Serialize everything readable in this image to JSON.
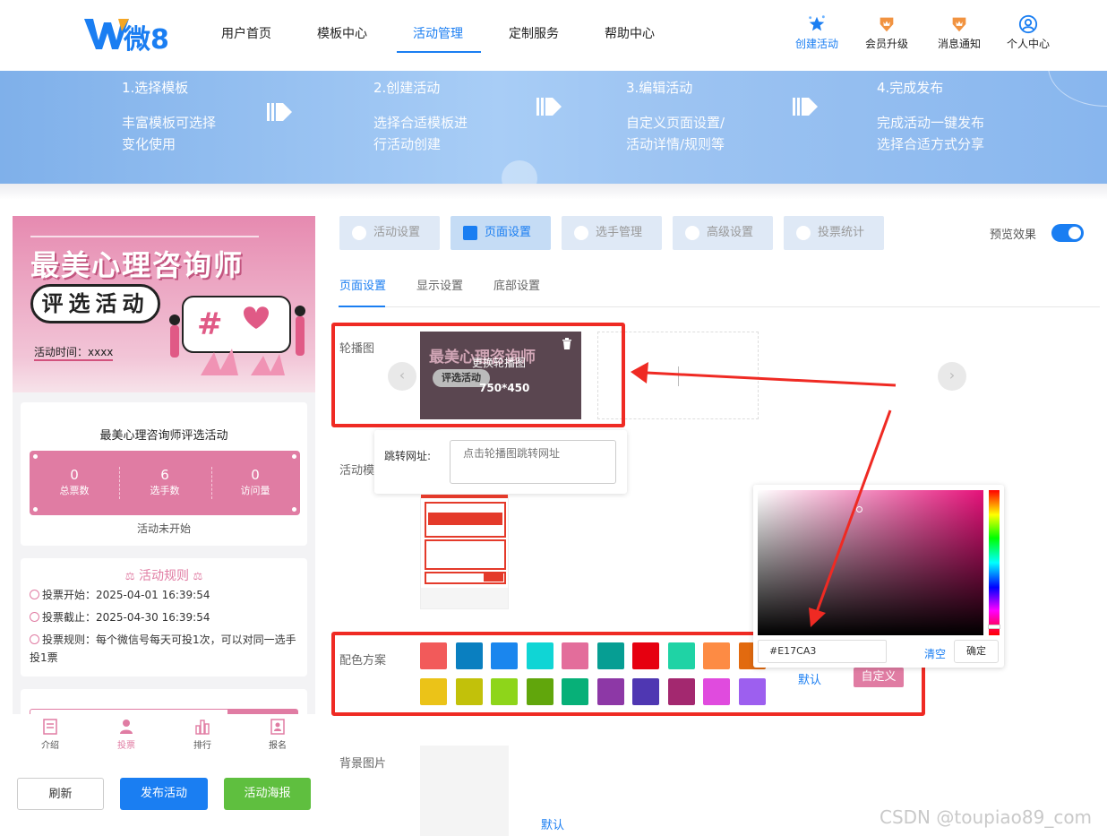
{
  "header": {
    "logo_text": "微8",
    "nav": [
      {
        "label": "用户首页"
      },
      {
        "label": "模板中心"
      },
      {
        "label": "活动管理"
      },
      {
        "label": "定制服务"
      },
      {
        "label": "帮助中心"
      }
    ],
    "active_nav": "活动管理",
    "tools": [
      {
        "label": "创建活动",
        "icon": "stars-icon"
      },
      {
        "label": "会员升级",
        "icon": "crown-badge-icon"
      },
      {
        "label": "消息通知",
        "icon": "crown-badge-icon"
      },
      {
        "label": "个人中心",
        "icon": "user-circle-icon"
      }
    ]
  },
  "steps": [
    {
      "title": "1.选择模板",
      "line1": "丰富模板可选择",
      "line2": "变化使用"
    },
    {
      "title": "2.创建活动",
      "line1": "选择合适模板进",
      "line2": "行活动创建"
    },
    {
      "title": "3.编辑活动",
      "line1": "自定义页面设置/",
      "line2": "活动详情/规则等"
    },
    {
      "title": "4.完成发布",
      "line1": "完成活动一键发布",
      "line2": "选择合适方式分享"
    }
  ],
  "preview": {
    "poster_title": "最美心理咨询师",
    "poster_subtitle": "评选活动",
    "poster_time": "活动时间：xxxx",
    "activity_name": "最美心理咨询师评选活动",
    "stats": [
      {
        "value": "0",
        "label": "总票数"
      },
      {
        "value": "6",
        "label": "选手数"
      },
      {
        "value": "0",
        "label": "访问量"
      }
    ],
    "status": "活动未开始",
    "rules_title": "活动规则",
    "rules": [
      {
        "label": "投票开始：",
        "value": "2025-04-01 16:39:54"
      },
      {
        "label": "投票截止：",
        "value": "2025-04-30 16:39:54"
      },
      {
        "label": "投票规则：",
        "value": "每个微信号每天可投1次，可以对同一选手投1票"
      }
    ],
    "bottom_tabs": [
      {
        "label": "介绍",
        "icon": "intro-icon"
      },
      {
        "label": "投票",
        "icon": "user-icon"
      },
      {
        "label": "排行",
        "icon": "rank-icon"
      },
      {
        "label": "报名",
        "icon": "signup-icon"
      }
    ],
    "active_tab": "投票"
  },
  "actions": {
    "refresh": "刷新",
    "publish": "发布活动",
    "poster": "活动海报"
  },
  "settings_tabs": [
    {
      "label": "活动设置"
    },
    {
      "label": "页面设置"
    },
    {
      "label": "选手管理"
    },
    {
      "label": "高级设置"
    },
    {
      "label": "投票统计"
    }
  ],
  "active_settings_tab": "页面设置",
  "preview_toggle": {
    "label": "预览效果",
    "on": true
  },
  "sub_tabs": [
    {
      "label": "页面设置"
    },
    {
      "label": "显示设置"
    },
    {
      "label": "底部设置"
    }
  ],
  "carousel": {
    "label": "轮播图",
    "replace_text": "更换轮播图",
    "size_text": "750*450",
    "link_label": "跳转网址:",
    "link_placeholder": "点击轮播图跳转网址"
  },
  "template_label": "活动模",
  "color_scheme": {
    "label": "配色方案",
    "swatches": [
      "#f25a5a",
      "#0a7fc0",
      "#1a86ee",
      "#10d5d5",
      "#e36d9b",
      "#069e93",
      "#e60010",
      "#1fd3a5",
      "#fd8b44",
      "#e26a0f",
      "#ebc318",
      "#c2c10a",
      "#8ed51a",
      "#61a60c",
      "#07b078",
      "#8d38a6",
      "#4f37b2",
      "#a3286f",
      "#e04bde",
      "#9d5fef"
    ],
    "default_label": "默认",
    "custom_label": "自定义",
    "custom_color": "#E17CA3"
  },
  "color_picker": {
    "hex_value": "#E17CA3",
    "clear_label": "清空",
    "confirm_label": "确定"
  },
  "background": {
    "label": "背景图片",
    "default_label": "默认"
  },
  "watermark": "CSDN @toupiao89_com",
  "colors": {
    "brand_blue": "#1a7ef2",
    "theme_pink": "#e07ca3",
    "annotation_red": "#ef2a23",
    "publish_green": "#5fbf3f"
  }
}
